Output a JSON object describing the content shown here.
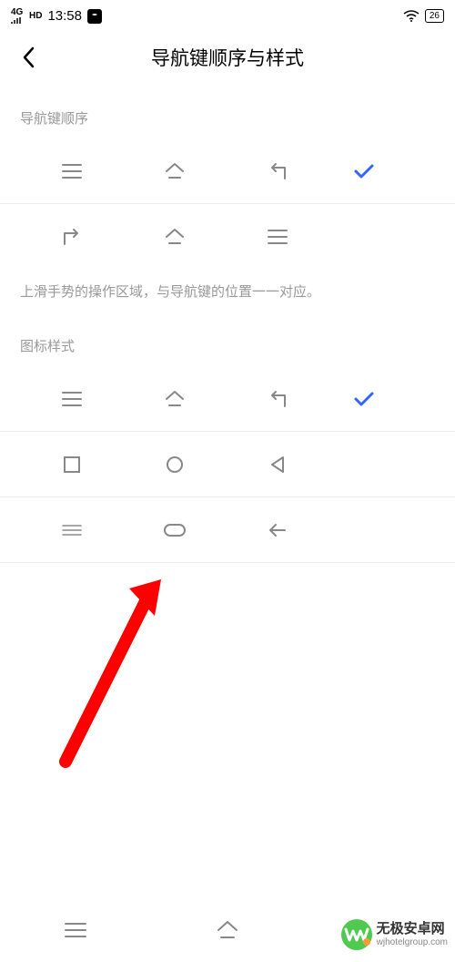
{
  "statusBar": {
    "signal": "4G",
    "hd": "HD",
    "time": "13:58",
    "battery": "26"
  },
  "header": {
    "title": "导航键顺序与样式"
  },
  "sections": {
    "orderLabel": "导航键顺序",
    "orderDesc": "上滑手势的操作区域，与导航键的位置一一对应。",
    "styleLabel": "图标样式"
  },
  "watermark": {
    "brand": "无极安卓网",
    "url": "wjhotelgroup.com"
  },
  "colors": {
    "accent": "#3366ff",
    "iconGray": "#888888",
    "arrow": "#ff0000"
  }
}
